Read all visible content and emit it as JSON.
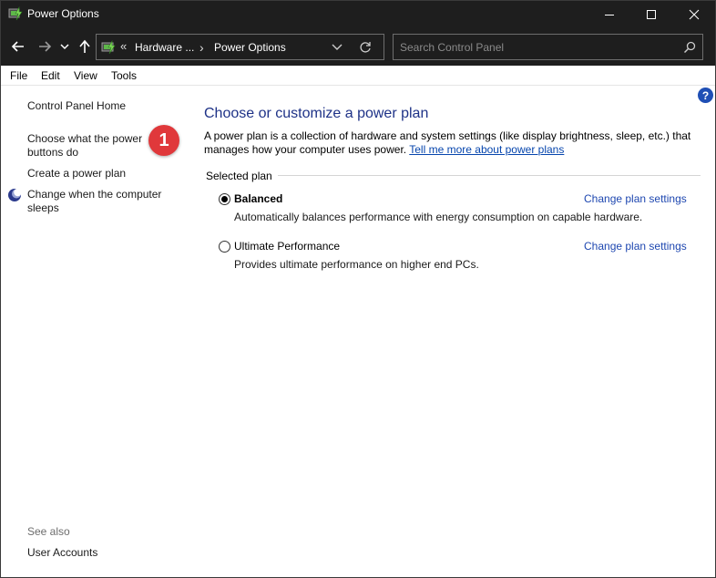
{
  "window": {
    "title": "Power Options",
    "icons": {
      "app": "power-options-icon",
      "minimize": "minimize-icon",
      "maximize": "maximize-icon",
      "close": "close-icon"
    }
  },
  "nav": {
    "back_icon": "arrow-left-icon",
    "forward_icon": "arrow-right-icon",
    "recent_icon": "chevron-down-icon",
    "up_icon": "arrow-up-icon",
    "breadcrumb_sep": "«",
    "breadcrumbs": [
      "Hardware ...",
      "Power Options"
    ],
    "crumb_arrow": "›",
    "search_placeholder": "Search Control Panel"
  },
  "menu": [
    "File",
    "Edit",
    "View",
    "Tools"
  ],
  "sidebar": {
    "home": "Control Panel Home",
    "links": [
      "Choose what the power buttons do",
      "Create a power plan",
      "Change when the computer sleeps"
    ],
    "badge": "1",
    "see_also_label": "See also",
    "see_also_links": [
      "User Accounts"
    ]
  },
  "main": {
    "help": "?",
    "title": "Choose or customize a power plan",
    "intro": "A power plan is a collection of hardware and system settings (like display brightness, sleep, etc.) that manages how your computer uses power.",
    "intro_link": "Tell me more about power plans",
    "group_label": "Selected plan",
    "plans": [
      {
        "name": "Balanced",
        "selected": true,
        "description": "Automatically balances performance with energy consumption on capable hardware.",
        "link": "Change plan settings"
      },
      {
        "name": "Ultimate Performance",
        "selected": false,
        "description": "Provides ultimate performance on higher end PCs.",
        "link": "Change plan settings"
      }
    ]
  },
  "colors": {
    "titlebar": "#1e1e1e",
    "heading": "#1e3287",
    "link": "#1e47b0",
    "badge": "#e0383b",
    "help": "#1f4fb5"
  }
}
